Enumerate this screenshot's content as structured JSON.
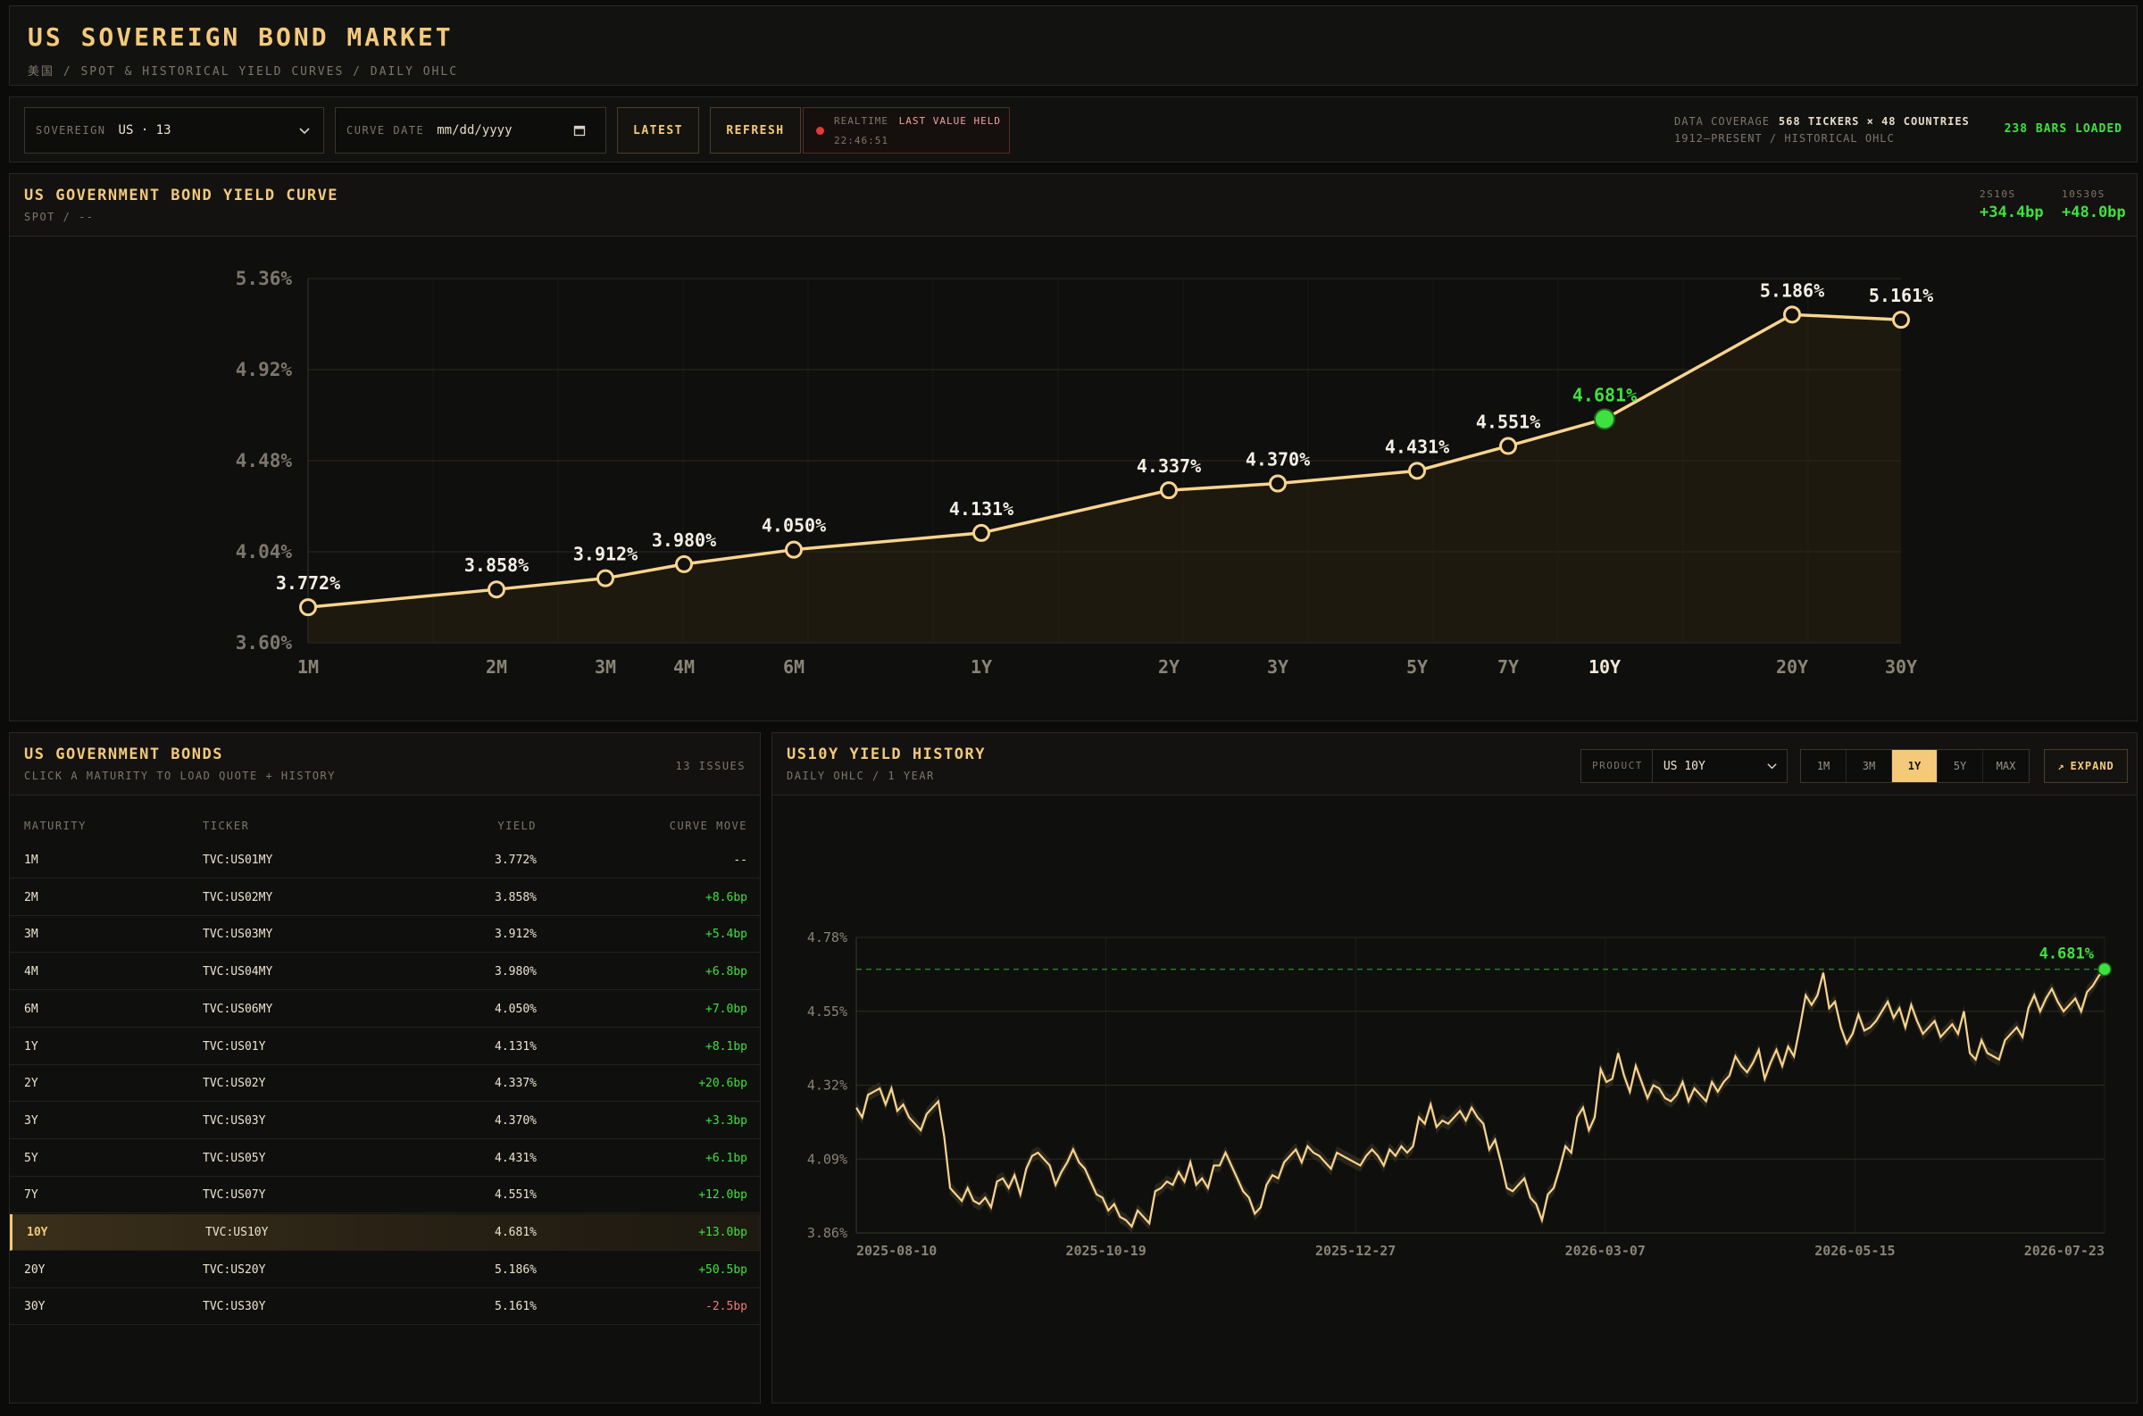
{
  "header": {
    "title": "US SOVEREIGN BOND MARKET",
    "subtitle": "美国 / SPOT & HISTORICAL YIELD CURVES / DAILY OHLC"
  },
  "toolbar": {
    "sovereign_label": "SOVEREIGN",
    "sovereign_value": "US · 13",
    "curve_date_label": "CURVE DATE",
    "curve_date_placeholder": "mm/dd/yyyy",
    "latest_label": "LATEST",
    "refresh_label": "REFRESH",
    "realtime_label": "REALTIME",
    "realtime_status": "LAST VALUE HELD",
    "realtime_time": "22:46:51",
    "coverage_label": "DATA COVERAGE",
    "coverage_value": "568 TICKERS × 48 COUNTRIES",
    "coverage_range": "1912–PRESENT / HISTORICAL OHLC",
    "bars_loaded": "238 BARS LOADED",
    "status_colors": {
      "realtime": "#e23a3a",
      "positive": "#3ee23e",
      "negative": "#f07a7a",
      "accent": "#f4c97a"
    }
  },
  "curve_panel": {
    "title": "US GOVERNMENT BOND YIELD CURVE",
    "subtitle": "SPOT / --",
    "spreads": [
      {
        "label": "2S10S",
        "value": "+34.4bp"
      },
      {
        "label": "10S30S",
        "value": "+48.0bp"
      }
    ]
  },
  "bonds_panel": {
    "title": "US GOVERNMENT BONDS",
    "subtitle": "CLICK A MATURITY TO LOAD QUOTE + HISTORY",
    "count": "13 ISSUES",
    "columns": [
      "MATURITY",
      "TICKER",
      "YIELD",
      "CURVE MOVE"
    ],
    "rows": [
      {
        "maturity": "1M",
        "ticker": "TVC:US01MY",
        "yield": "3.772%",
        "move": "--",
        "dir": "flat"
      },
      {
        "maturity": "2M",
        "ticker": "TVC:US02MY",
        "yield": "3.858%",
        "move": "+8.6bp",
        "dir": "up"
      },
      {
        "maturity": "3M",
        "ticker": "TVC:US03MY",
        "yield": "3.912%",
        "move": "+5.4bp",
        "dir": "up"
      },
      {
        "maturity": "4M",
        "ticker": "TVC:US04MY",
        "yield": "3.980%",
        "move": "+6.8bp",
        "dir": "up"
      },
      {
        "maturity": "6M",
        "ticker": "TVC:US06MY",
        "yield": "4.050%",
        "move": "+7.0bp",
        "dir": "up"
      },
      {
        "maturity": "1Y",
        "ticker": "TVC:US01Y",
        "yield": "4.131%",
        "move": "+8.1bp",
        "dir": "up"
      },
      {
        "maturity": "2Y",
        "ticker": "TVC:US02Y",
        "yield": "4.337%",
        "move": "+20.6bp",
        "dir": "up"
      },
      {
        "maturity": "3Y",
        "ticker": "TVC:US03Y",
        "yield": "4.370%",
        "move": "+3.3bp",
        "dir": "up"
      },
      {
        "maturity": "5Y",
        "ticker": "TVC:US05Y",
        "yield": "4.431%",
        "move": "+6.1bp",
        "dir": "up"
      },
      {
        "maturity": "7Y",
        "ticker": "TVC:US07Y",
        "yield": "4.551%",
        "move": "+12.0bp",
        "dir": "up"
      },
      {
        "maturity": "10Y",
        "ticker": "TVC:US10Y",
        "yield": "4.681%",
        "move": "+13.0bp",
        "dir": "up",
        "selected": true
      },
      {
        "maturity": "20Y",
        "ticker": "TVC:US20Y",
        "yield": "5.186%",
        "move": "+50.5bp",
        "dir": "up"
      },
      {
        "maturity": "30Y",
        "ticker": "TVC:US30Y",
        "yield": "5.161%",
        "move": "-2.5bp",
        "dir": "down"
      }
    ]
  },
  "history_panel": {
    "title": "US10Y YIELD HISTORY",
    "subtitle": "DAILY OHLC / 1 YEAR",
    "product_label": "PRODUCT",
    "product_value": "US 10Y",
    "ranges": [
      "1M",
      "3M",
      "1Y",
      "5Y",
      "MAX"
    ],
    "active_range": "1Y",
    "expand_label": "EXPAND"
  },
  "chart_data": [
    {
      "type": "line",
      "categories": [
        "1M",
        "2M",
        "3M",
        "4M",
        "6M",
        "1Y",
        "2Y",
        "3Y",
        "5Y",
        "7Y",
        "10Y",
        "20Y",
        "30Y"
      ],
      "x_years": [
        0.0833,
        0.1667,
        0.25,
        0.3333,
        0.5,
        1,
        2,
        3,
        5,
        7,
        10,
        20,
        30
      ],
      "values": [
        3.772,
        3.858,
        3.912,
        3.98,
        4.05,
        4.131,
        4.337,
        4.37,
        4.431,
        4.551,
        4.681,
        5.186,
        5.161
      ],
      "value_labels": [
        "3.772%",
        "3.858%",
        "3.912%",
        "3.980%",
        "4.050%",
        "4.131%",
        "4.337%",
        "4.370%",
        "4.431%",
        "4.551%",
        "4.681%",
        "5.186%",
        "5.161%"
      ],
      "highlight": "10Y",
      "yticks": [
        "5.36%",
        "4.92%",
        "4.48%",
        "4.04%",
        "3.60%"
      ],
      "ylim": [
        3.6,
        5.36
      ],
      "grid": true,
      "title": "",
      "xlabel": "",
      "ylabel": "",
      "line_color": "#f9d48e",
      "highlight_color": "#3ee23e"
    },
    {
      "type": "line",
      "x_start": "2025-08-10",
      "x_end": "2026-07-23",
      "xticks": [
        "2025-08-10",
        "2025-10-19",
        "2025-12-27",
        "2026-03-07",
        "2026-05-15",
        "2026-07-23"
      ],
      "yticks": [
        "4.78%",
        "4.55%",
        "4.32%",
        "4.09%",
        "3.86%"
      ],
      "ylim": [
        3.86,
        4.78
      ],
      "last_value": 4.681,
      "last_label": "4.681%",
      "grid": true,
      "series": [
        {
          "values": [
            4.25,
            4.22,
            4.29,
            4.3,
            4.31,
            4.26,
            4.31,
            4.24,
            4.26,
            4.22,
            4.2,
            4.18,
            4.23,
            4.25,
            4.27,
            4.16,
            4.0,
            3.98,
            3.96,
            4.0,
            3.96,
            3.95,
            3.97,
            3.94,
            4.02,
            4.03,
            4.0,
            4.04,
            3.98,
            4.06,
            4.1,
            4.11,
            4.09,
            4.07,
            4.01,
            4.05,
            4.08,
            4.12,
            4.08,
            4.06,
            4.02,
            3.98,
            3.97,
            3.93,
            3.95,
            3.91,
            3.9,
            3.88,
            3.93,
            3.91,
            3.89,
            3.99,
            4.0,
            4.02,
            4.01,
            4.05,
            4.02,
            4.08,
            4.01,
            4.03,
            4.0,
            4.07,
            4.07,
            4.11,
            4.07,
            4.03,
            3.99,
            3.97,
            3.92,
            3.94,
            4.01,
            4.04,
            4.03,
            4.08,
            4.1,
            4.12,
            4.08,
            4.13,
            4.11,
            4.1,
            4.08,
            4.06,
            4.11,
            4.1,
            4.09,
            4.08,
            4.07,
            4.1,
            4.12,
            4.1,
            4.07,
            4.12,
            4.1,
            4.13,
            4.11,
            4.13,
            4.22,
            4.2,
            4.26,
            4.19,
            4.21,
            4.2,
            4.22,
            4.24,
            4.21,
            4.25,
            4.22,
            4.2,
            4.12,
            4.15,
            4.08,
            4.0,
            3.99,
            4.01,
            4.03,
            3.97,
            3.95,
            3.9,
            3.98,
            4.0,
            4.06,
            4.13,
            4.11,
            4.22,
            4.25,
            4.18,
            4.22,
            4.37,
            4.33,
            4.34,
            4.42,
            4.35,
            4.3,
            4.38,
            4.33,
            4.28,
            4.32,
            4.31,
            4.28,
            4.27,
            4.29,
            4.33,
            4.27,
            4.31,
            4.29,
            4.27,
            4.33,
            4.3,
            4.33,
            4.35,
            4.41,
            4.38,
            4.36,
            4.39,
            4.43,
            4.34,
            4.39,
            4.43,
            4.38,
            4.44,
            4.41,
            4.5,
            4.6,
            4.57,
            4.6,
            4.67,
            4.56,
            4.58,
            4.5,
            4.45,
            4.48,
            4.54,
            4.49,
            4.5,
            4.52,
            4.55,
            4.58,
            4.53,
            4.56,
            4.5,
            4.57,
            4.52,
            4.48,
            4.5,
            4.52,
            4.47,
            4.49,
            4.51,
            4.48,
            4.55,
            4.42,
            4.4,
            4.46,
            4.42,
            4.41,
            4.4,
            4.46,
            4.48,
            4.5,
            4.47,
            4.56,
            4.6,
            4.55,
            4.59,
            4.62,
            4.58,
            4.55,
            4.57,
            4.59,
            4.55,
            4.61,
            4.63,
            4.66,
            4.681
          ]
        }
      ]
    }
  ]
}
